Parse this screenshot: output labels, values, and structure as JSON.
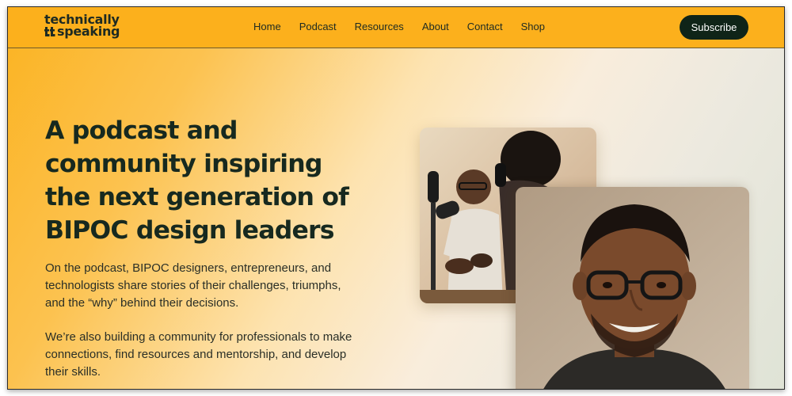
{
  "brand": {
    "line1": "technically",
    "line2": "speaking"
  },
  "nav": {
    "items": [
      {
        "label": "Home"
      },
      {
        "label": "Podcast"
      },
      {
        "label": "Resources"
      },
      {
        "label": "About"
      },
      {
        "label": "Contact"
      },
      {
        "label": "Shop"
      }
    ]
  },
  "header": {
    "subscribe_label": "Subscribe"
  },
  "hero": {
    "headline_lines": [
      "A podcast and",
      "community inspiring",
      "the next generation of",
      "BIPOC design leaders"
    ],
    "paragraph1_lines": [
      "On the podcast, BIPOC designers, entrepreneurs, and",
      "technologists share stories of their challenges, triumphs,",
      "and the “why” behind their decisions."
    ],
    "paragraph2_lines": [
      "We’re also building a community for professionals to make",
      "connections, find resources and mentorship, and develop",
      "their skills."
    ]
  },
  "colors": {
    "header_bg": "#fcb01c",
    "accent_dark": "#0f2418",
    "text_dark": "#17291f"
  }
}
